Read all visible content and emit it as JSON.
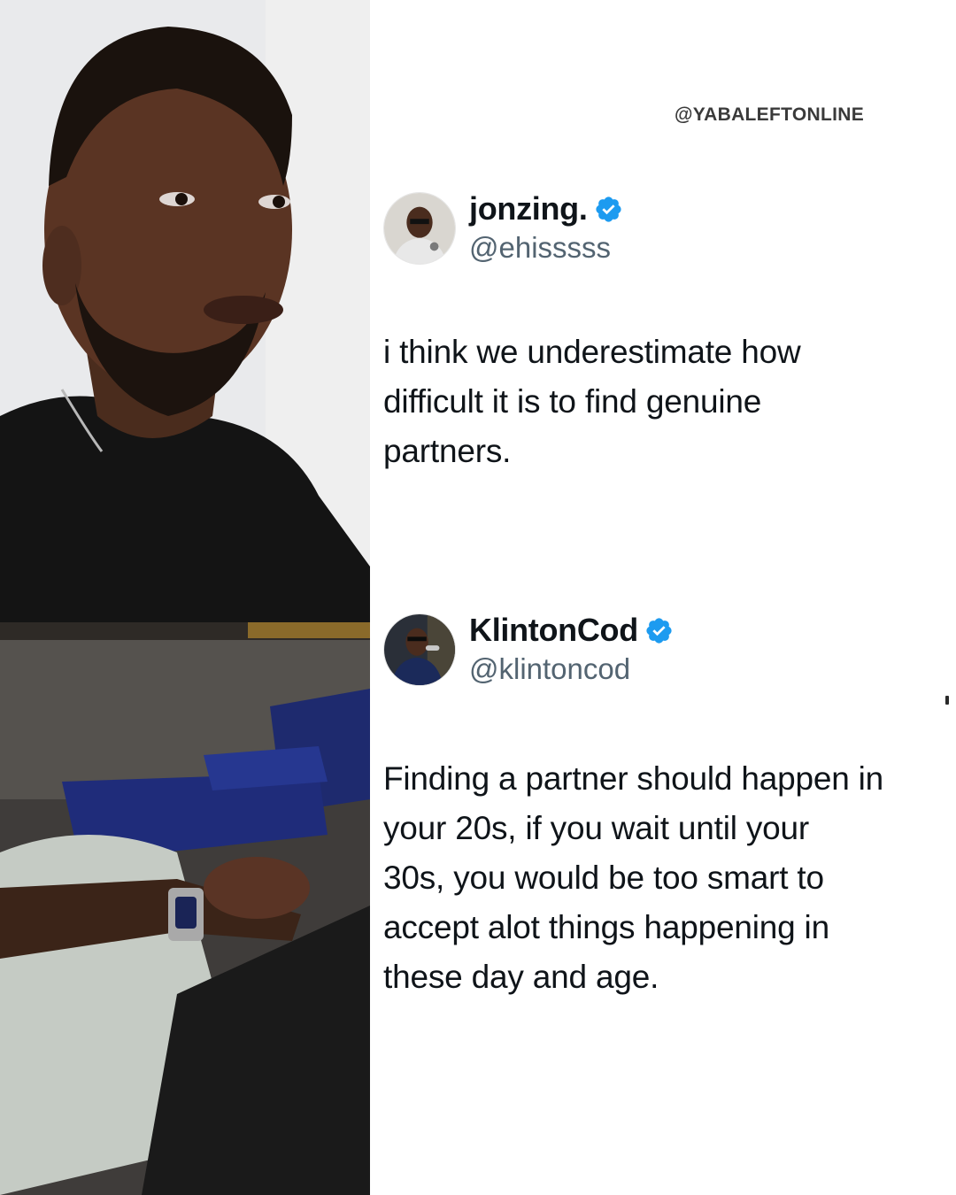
{
  "watermark": "@YABALEFTONLINE",
  "tweets": [
    {
      "display_name": "jonzing.",
      "handle": "@ehisssss",
      "verified": true,
      "text": "i think we underestimate how\ndifficult it is to find genuine\npartners."
    },
    {
      "display_name": "KlintonCod",
      "handle": "@klintoncod",
      "verified": true,
      "text": "Finding a partner should happen in\nyour 20s, if you wait until your\n30s, you would be too smart to\naccept alot things happening in\nthese day and age."
    }
  ],
  "colors": {
    "text": "#0f1419",
    "handle": "#536471",
    "verified_badge": "#1d9bf0",
    "background": "#ffffff"
  }
}
